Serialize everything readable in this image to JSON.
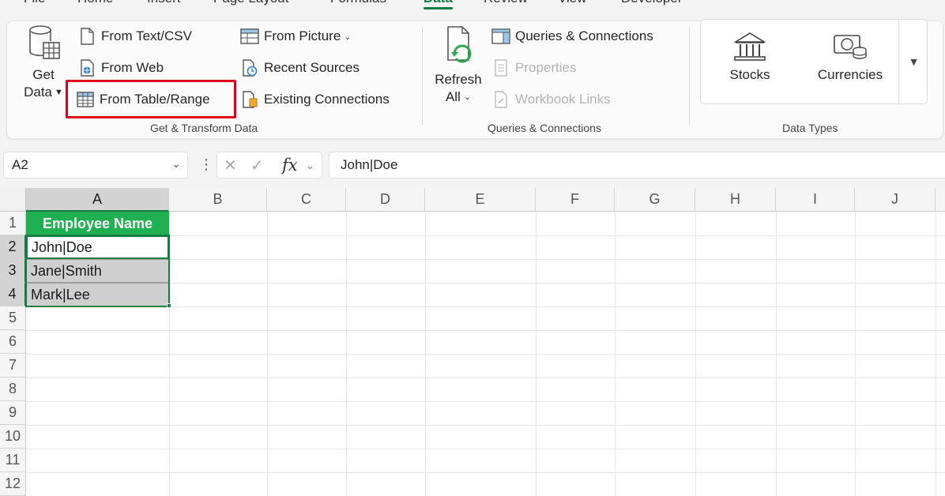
{
  "tabs": [
    {
      "label": "File"
    },
    {
      "label": "Home"
    },
    {
      "label": "Insert"
    },
    {
      "label": "Page Layout"
    },
    {
      "label": "Formulas"
    },
    {
      "label": "Data"
    },
    {
      "label": "Review"
    },
    {
      "label": "View"
    },
    {
      "label": "Developer"
    }
  ],
  "active_tab": "Data",
  "ribbon": {
    "get_transform": {
      "get_data_line1": "Get",
      "get_data_line2": "Data",
      "from_text_csv": "From Text/CSV",
      "from_web": "From Web",
      "from_table_range": "From Table/Range",
      "from_picture": "From Picture",
      "recent_sources": "Recent Sources",
      "existing_connections": "Existing Connections",
      "group_label": "Get & Transform Data"
    },
    "queries": {
      "refresh_line1": "Refresh",
      "refresh_line2": "All",
      "queries_connections": "Queries & Connections",
      "properties": "Properties",
      "workbook_links": "Workbook Links",
      "group_label": "Queries & Connections"
    },
    "data_types": {
      "stocks": "Stocks",
      "currencies": "Currencies",
      "group_label": "Data Types"
    }
  },
  "formula_bar": {
    "name_box": "A2",
    "formula": "John|Doe"
  },
  "columns": [
    "A",
    "B",
    "C",
    "D",
    "E",
    "F",
    "G",
    "H",
    "I",
    "J"
  ],
  "rows": [
    "1",
    "2",
    "3",
    "4",
    "5",
    "6",
    "7",
    "8",
    "9",
    "10",
    "11",
    "12"
  ],
  "cells": {
    "A1": "Employee Name",
    "A2": "John|Doe",
    "A3": "Jane|Smith",
    "A4": "Mark|Lee"
  },
  "colors": {
    "accent": "#107c41",
    "header_fill": "#1fb151",
    "highlight": "#e3001b"
  }
}
